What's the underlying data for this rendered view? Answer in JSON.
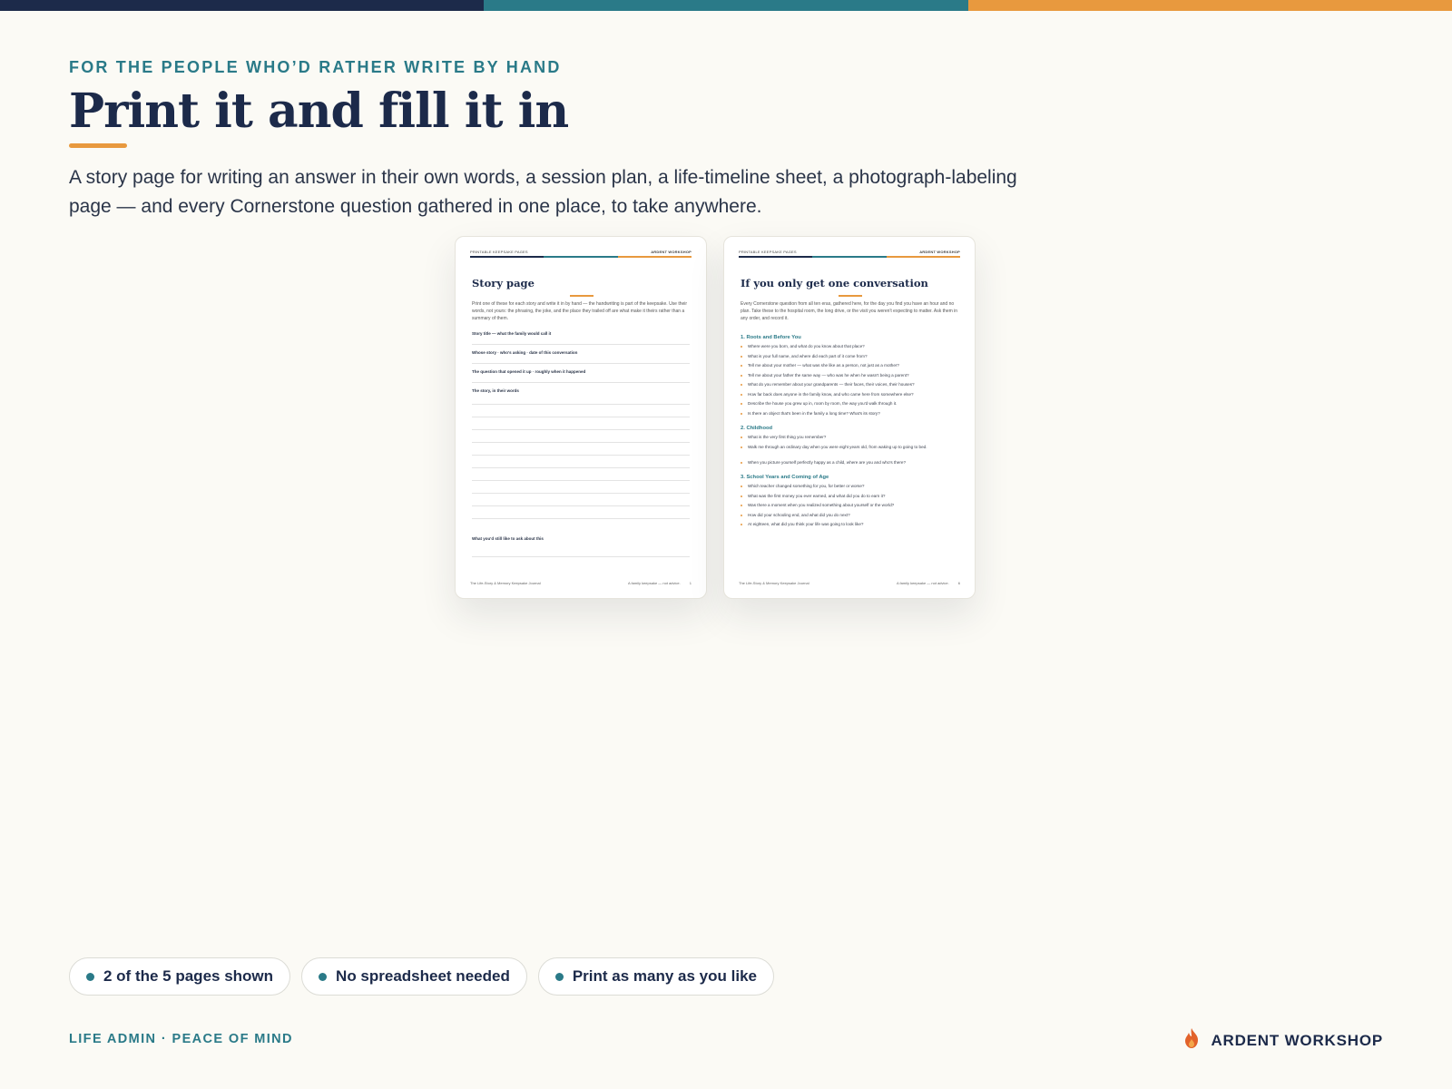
{
  "colors": {
    "navy": "#1c2a4a",
    "teal": "#2a7a88",
    "orange": "#e8993e",
    "background": "#fbfaf5"
  },
  "header": {
    "eyebrow": "FOR THE PEOPLE WHO’D RATHER WRITE BY HAND",
    "title": "Print it and fill it in",
    "intro": "A story page for writing an answer in their own words, a session plan, a life-timeline sheet, a photograph-labeling page — and every Cornerstone question gathered in one place, to take anywhere."
  },
  "story_page": {
    "head_left": "PRINTABLE KEEPSAKE PAGES",
    "head_right": "ARDENT WORKSHOP",
    "title": "Story page",
    "intro": "Print one of these for each story and write it in by hand — the handwriting is part of the keepsake. Use their words, not yours: the phrasing, the joke, and the place they trailed off are what make it theirs rather than a summary of them.",
    "fields": [
      "Story title — what the family would call it",
      "Whose story · who's asking · date of this conversation",
      "The question that opened it up · roughly when it happened",
      "The story, in their words",
      "What you'd still like to ask about this"
    ],
    "foot_left": "The Life-Story & Memory Keepsake Journal",
    "foot_middle": "A family keepsake — not advice.",
    "foot_page": "1"
  },
  "questions_page": {
    "head_left": "PRINTABLE KEEPSAKE PAGES",
    "head_right": "ARDENT WORKSHOP",
    "title": "If you only get one conversation",
    "intro": "Every Cornerstone question from all ten eras, gathered here, for the day you find you have an hour and no plan. Take these to the hospital room, the long drive, or the visit you weren't expecting to matter. Ask them in any order, and record it.",
    "sections": [
      {
        "heading": "1. Roots and Before You",
        "questions": [
          "Where were you born, and what do you know about that place?",
          "What is your full name, and where did each part of it come from?",
          "Tell me about your mother — what was she like as a person, not just as a mother?",
          "Tell me about your father the same way — who was he when he wasn't being a parent?",
          "What do you remember about your grandparents — their faces, their voices, their houses?",
          "How far back does anyone in the family know, and who came here from somewhere else?",
          "Describe the house you grew up in, room by room, the way you'd walk through it.",
          "Is there an object that's been in the family a long time? What's its story?"
        ]
      },
      {
        "heading": "2. Childhood",
        "questions": [
          "What is the very first thing you remember?",
          "Walk me through an ordinary day when you were eight years old, from waking up to going to bed.",
          "When you picture yourself perfectly happy as a child, where are you and who's there?"
        ]
      },
      {
        "heading": "3. School Years and Coming of Age",
        "questions": [
          "Which teacher changed something for you, for better or worse?",
          "What was the first money you ever earned, and what did you do to earn it?",
          "Was there a moment when you realized something about yourself or the world?",
          "How did your schooling end, and what did you do next?",
          "At eighteen, what did you think your life was going to look like?"
        ]
      }
    ],
    "foot_left": "The Life-Story & Memory Keepsake Journal",
    "foot_middle": "A family keepsake — not advice.",
    "foot_page": "6"
  },
  "chips": [
    "2 of the 5 pages shown",
    "No spreadsheet needed",
    "Print as many as you like"
  ],
  "footer": {
    "left": "LIFE ADMIN · PEACE OF MIND",
    "brand": "ARDENT WORKSHOP",
    "brand_icon": "flame-icon"
  }
}
